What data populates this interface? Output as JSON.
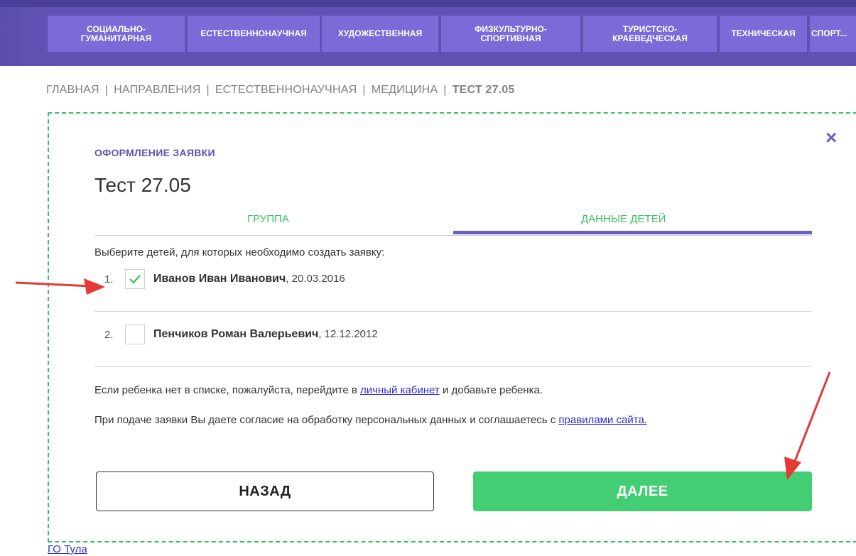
{
  "nav": {
    "items": [
      {
        "label": "СОЦИАЛЬНО-\nГУМАНИТАРНАЯ"
      },
      {
        "label": "ЕСТЕСТВЕННОНАУЧНАЯ"
      },
      {
        "label": "ХУДОЖЕСТВЕННАЯ"
      },
      {
        "label": "ФИЗКУЛЬТУРНО-\nСПОРТИВНАЯ"
      },
      {
        "label": "ТУРИСТСКО-\nКРАЕВЕДЧЕСКАЯ"
      },
      {
        "label": "ТЕХНИЧЕСКАЯ"
      },
      {
        "label": "СПОРТ..."
      }
    ]
  },
  "breadcrumb": {
    "items": [
      "ГЛАВНАЯ",
      "НАПРАВЛЕНИЯ",
      "ЕСТЕСТВЕННОНАУЧНАЯ",
      "МЕДИЦИНА"
    ],
    "current": "ТЕСТ 27.05",
    "separator": "|"
  },
  "modal": {
    "close_icon": "×",
    "subtitle": "ОФОРМЛЕНИЕ ЗАЯВКИ",
    "title": "Тест 27.05",
    "tabs": [
      {
        "label": "ГРУППА"
      },
      {
        "label": "ДАННЫЕ ДЕТЕЙ"
      }
    ],
    "active_tab": "ДАННЫЕ ДЕТЕЙ",
    "prompt": "Выберите детей, для которых необходимо создать заявку:",
    "children": [
      {
        "num": "1.",
        "name": "Иванов Иван Иванович",
        "date": ", 20.03.2016",
        "checked": true
      },
      {
        "num": "2.",
        "name": "Пенчиков Роман Валерьевич",
        "date": ", 12.12.2012",
        "checked": false
      }
    ],
    "info1_before": "Если ребенка нет в списке, пожалуйста, перейдите в ",
    "info1_link": "личный кабинет",
    "info1_after": "  и добавьте ребенка.",
    "info2_before": "При подаче заявки Вы даете согласие на обработку персональных данных и соглашаетесь с ",
    "info2_link": "правилами сайта.",
    "back_label": "НАЗАД",
    "next_label": "ДАЛЕЕ"
  },
  "footer": {
    "link": "ГО Тула"
  },
  "colors": {
    "nav_bg": "#5f52b3",
    "nav_item_bg": "#7a6bd8",
    "accent": "#6a5fc8",
    "green": "#44ce74",
    "arrow_red": "#e53935"
  }
}
